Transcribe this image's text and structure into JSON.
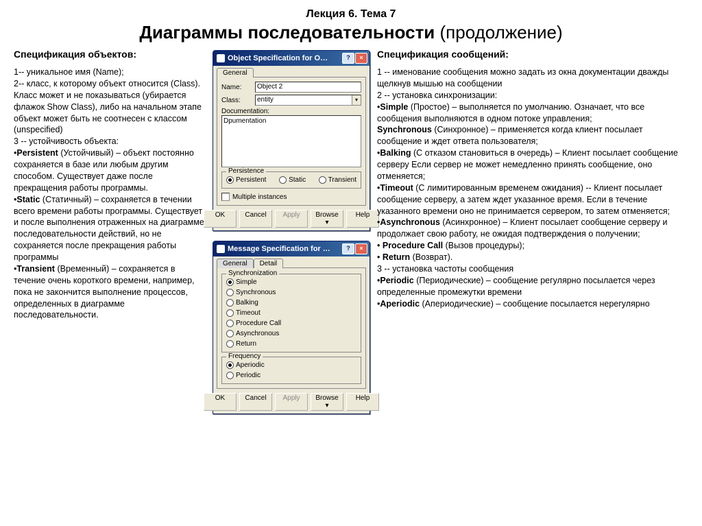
{
  "header": {
    "lecture": "Лекция 6. Тема 7",
    "title_bold": "Диаграммы последовательности",
    "title_rest": " (продолжение)"
  },
  "left": {
    "heading": "Спецификация объектов:",
    "p1": "1-- уникальное имя (Name);",
    "p2": "2-- класс, к которому объект относится (Class). Класс может и не показываться (убирается флажок Show Class), либо на начальном этапе объект может быть не соотнесен с классом (unspecified)",
    "p3": "3 -- устойчивость объекта:",
    "p4a": "Persistent",
    "p4b": " (Устойчивый) – объект постоянно сохраняется в базе или любым другим способом. Существует даже после прекращения работы программы.",
    "p5a": "Static",
    "p5b": " (Статичный) – сохраняется в течении всего времени работы программы. Существует и после выполнения отраженных на диаграмме последовательности действий, но не сохраняется после прекращения работы программы",
    "p6a": "Transient",
    "p6b": " (Временный) – сохраняется в течение очень короткого времени, например, пока не закончится выполнение процессов, определенных в диаграмме последовательности."
  },
  "right": {
    "heading": "Спецификация сообщений:",
    "r1": "1 -- именование сообщения можно задать из окна документации дважды щелкнув мышью на сообщении",
    "r2": "2 -- установка синхронизации:",
    "r3a": "Simple",
    "r3b": " (Простое) – выполняется по умолчанию. Означает, что все сообщения выполняются в одном потоке управления;",
    "r4a": "Synchronous",
    "r4b": " (Синхронное) – применяется когда клиент посылает сообщение и ждет ответа пользователя;",
    "r5a": "Balking",
    "r5b": " (С отказом становиться в очередь) – Клиент посылает сообщение серверу Если сервер не может немедленно принять сообщение, оно отменяется;",
    "r6a": "Timeout",
    "r6b": " (С лимитированным временем ожидания) -- Клиент посылает сообщение серверу, а затем ждет указанное время. Если в течение указанного времени оно не принимается сервером, то затем отменяется;",
    "r7a": "Asynchronous",
    "r7b": " (Асинхронное) – Клиент посылает сообщение серверу и продолжает свою работу, не ожидая подтверждения о получении;",
    "r8a": "Procedure Call",
    "r8b": " (Вызов процедуры);",
    "r9a": "Return",
    "r9b": " (Возврат).",
    "r10": "3 -- установка частоты сообщения",
    "r11a": "Periodic",
    "r11b": " (Периодические) – сообщение регулярно посылается через определенные промежутки времени",
    "r12a": "Aperiodic",
    "r12b": " (Апериодические) – сообщение посылается нерегулярно"
  },
  "dlg1": {
    "title": "Object Specification for O…",
    "tab": "General",
    "name_label": "Name:",
    "name_value": "Object 2",
    "class_label": "Class:",
    "class_value": "entity",
    "doc_label": "Documentation:",
    "doc_value": "Dpumentation",
    "group": "Persistence",
    "r_persist": "Persistent",
    "r_static": "Static",
    "r_trans": "Transient",
    "chk": "Multiple instances",
    "btn_ok": "OK",
    "btn_cancel": "Cancel",
    "btn_apply": "Apply",
    "btn_browse": "Browse ▾",
    "btn_help": "Help"
  },
  "dlg2": {
    "title": "Message Specification for …",
    "tab1": "General",
    "tab2": "Detail",
    "group1": "Synchronization",
    "s_simple": "Simple",
    "s_sync": "Synchronous",
    "s_balk": "Balking",
    "s_timeout": "Timeout",
    "s_proc": "Procedure Call",
    "s_async": "Asynchronous",
    "s_return": "Return",
    "group2": "Frequency",
    "f_aper": "Aperiodic",
    "f_per": "Periodic",
    "btn_ok": "OK",
    "btn_cancel": "Cancel",
    "btn_apply": "Apply",
    "btn_browse": "Browse ▾",
    "btn_help": "Help"
  }
}
